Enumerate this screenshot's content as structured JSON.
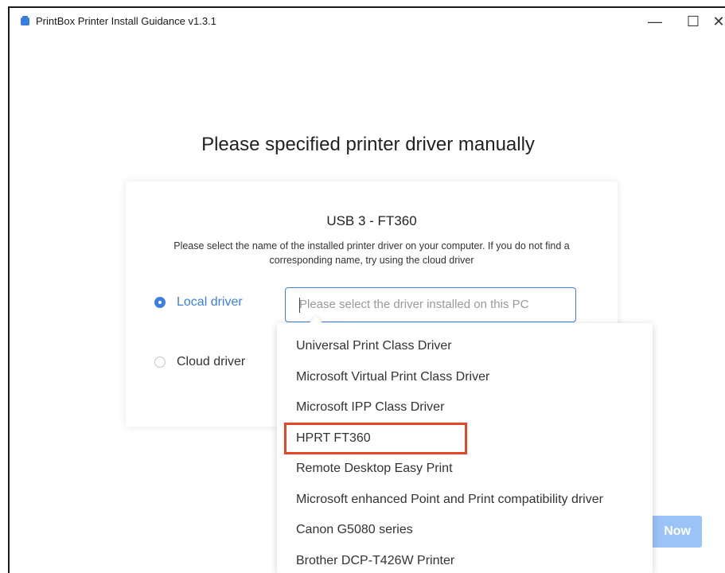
{
  "window": {
    "title": "PrintBox Printer Install Guidance v1.3.1",
    "minimize_glyph": "—",
    "maximize_glyph": "☐",
    "close_glyph": "✕"
  },
  "page": {
    "heading": "Please specified printer driver manually"
  },
  "card": {
    "device_name": "USB 3 - FT360",
    "instruction": "Please select the name of the installed printer driver on your computer. If you do not find a corresponding name, try using the cloud driver",
    "options": {
      "local_driver": "Local driver",
      "cloud_driver": "Cloud driver",
      "selected": "Local driver"
    },
    "select": {
      "placeholder": "Please select the driver installed on this PC"
    }
  },
  "dropdown": {
    "items": [
      "Universal Print Class Driver",
      "Microsoft Virtual Print Class Driver",
      "Microsoft IPP Class Driver",
      "HPRT FT360",
      "Remote Desktop Easy Print",
      "Microsoft enhanced Point and Print compatibility driver",
      "Canon G5080 series",
      "Brother DCP-T426W Printer"
    ],
    "highlighted": "HPRT FT360"
  },
  "footer": {
    "button_label": "Now"
  },
  "colors": {
    "accent": "#3d7fe0",
    "highlight_border": "#e5462a",
    "button_disabled": "#9cc3f7"
  }
}
